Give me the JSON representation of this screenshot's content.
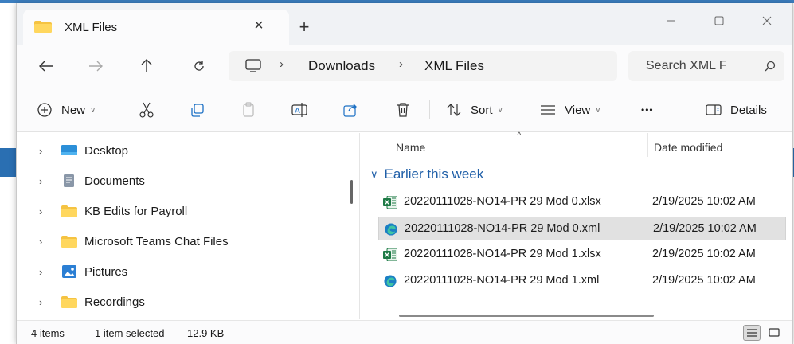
{
  "window": {
    "tab_title": "XML Files",
    "tab_close": "×",
    "new_tab": "+"
  },
  "nav": {
    "breadcrumb": [
      "Downloads",
      "XML Files"
    ],
    "search_placeholder": "Search XML F"
  },
  "toolbar": {
    "new_label": "New",
    "sort_label": "Sort",
    "view_label": "View",
    "more_label": "•••",
    "details_label": "Details"
  },
  "sidebar": {
    "items": [
      {
        "label": "Desktop",
        "icon": "desktop-icon"
      },
      {
        "label": "Documents",
        "icon": "documents-icon"
      },
      {
        "label": "KB Edits for Payroll",
        "icon": "folder-icon"
      },
      {
        "label": "Microsoft Teams Chat Files",
        "icon": "folder-icon"
      },
      {
        "label": "Pictures",
        "icon": "pictures-icon"
      },
      {
        "label": "Recordings",
        "icon": "folder-icon"
      }
    ]
  },
  "content": {
    "columns": {
      "name": "Name",
      "date": "Date modified"
    },
    "group_label": "Earlier this week",
    "files": [
      {
        "name": "20220111028-NO14-PR 29 Mod 0.xlsx",
        "date": "2/19/2025 10:02 AM",
        "type": "excel",
        "selected": false
      },
      {
        "name": "20220111028-NO14-PR 29 Mod 0.xml",
        "date": "2/19/2025 10:02 AM",
        "type": "edge",
        "selected": true
      },
      {
        "name": "20220111028-NO14-PR 29 Mod 1.xlsx",
        "date": "2/19/2025 10:02 AM",
        "type": "excel",
        "selected": false
      },
      {
        "name": "20220111028-NO14-PR 29 Mod 1.xml",
        "date": "2/19/2025 10:02 AM",
        "type": "edge",
        "selected": false
      }
    ]
  },
  "status": {
    "item_count": "4 items",
    "selection": "1 item selected",
    "size": "12.9 KB"
  },
  "colors": {
    "accent": "#1f5fa8",
    "folder": "#f5c342",
    "excel": "#1d7a45",
    "edge": "#1b7fc4"
  }
}
